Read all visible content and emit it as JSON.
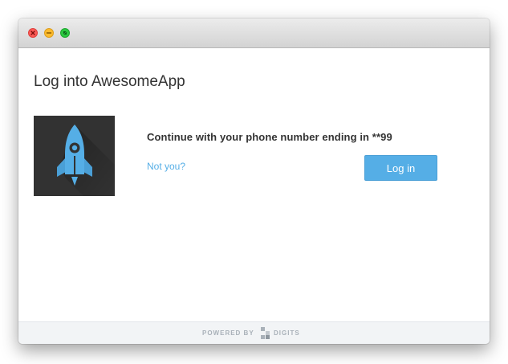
{
  "window": {
    "controls": {
      "close_icon": "close-icon",
      "minimize_icon": "minimize-icon",
      "maximize_icon": "fullscreen-icon"
    }
  },
  "dialog": {
    "title": "Log into AwesomeApp",
    "app_icon": "rocket-icon",
    "prompt": "Continue with your phone number ending in **99",
    "not_you_link": "Not you?",
    "login_button": "Log in"
  },
  "footer": {
    "powered_by": "POWERED BY",
    "brand": "DIGITS",
    "brand_icon": "digits-logo-icon"
  },
  "colors": {
    "accent": "#55aee6",
    "icon_background": "#323232",
    "footer_background": "#f2f4f6",
    "close": "#fc5b57",
    "minimize": "#fdbb2d",
    "maximize": "#2bc840"
  }
}
